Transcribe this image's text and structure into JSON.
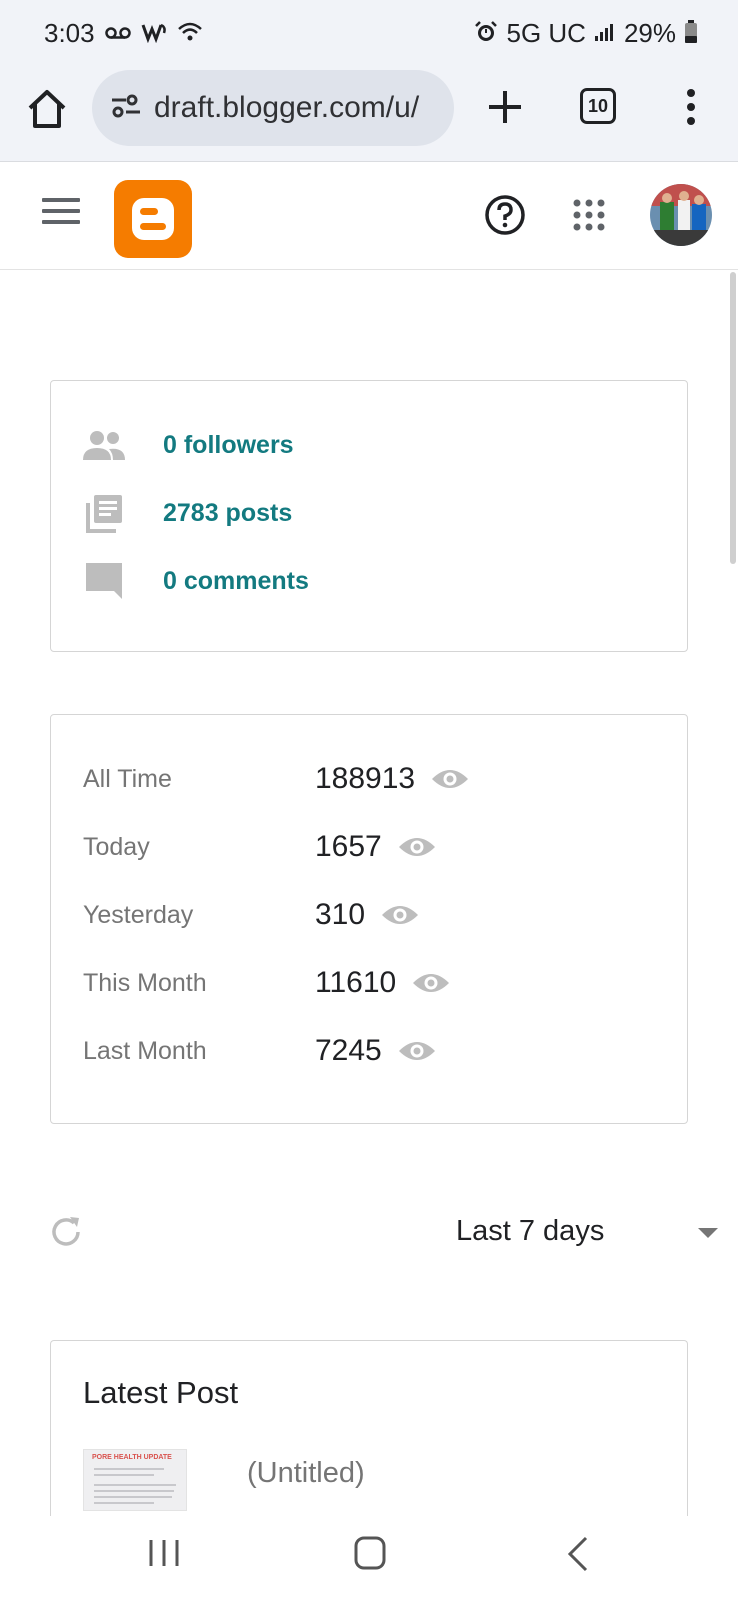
{
  "status_bar": {
    "time": "3:03",
    "network": "5G UC",
    "battery": "29%",
    "icons": [
      "voicemail-icon",
      "wifi-calling-icon",
      "wifi-icon",
      "alarm-icon",
      "signal-icon",
      "battery-icon"
    ]
  },
  "browser": {
    "url": "draft.blogger.com/u/",
    "tab_count": "10"
  },
  "blogger": {
    "logo_color": "#f57c00",
    "accent_color": "#137a80"
  },
  "counts": {
    "followers": "0 followers",
    "posts": "2783 posts",
    "comments": "0 comments"
  },
  "stats": [
    {
      "label": "All Time",
      "value": "188913"
    },
    {
      "label": "Today",
      "value": "1657"
    },
    {
      "label": "Yesterday",
      "value": "310"
    },
    {
      "label": "This Month",
      "value": "11610"
    },
    {
      "label": "Last Month",
      "value": "7245"
    }
  ],
  "range": {
    "selected": "Last 7 days"
  },
  "latest_post": {
    "heading": "Latest Post",
    "title": "(Untitled)",
    "thumbnail_caption": "PORE HEALTH UPDATE"
  }
}
